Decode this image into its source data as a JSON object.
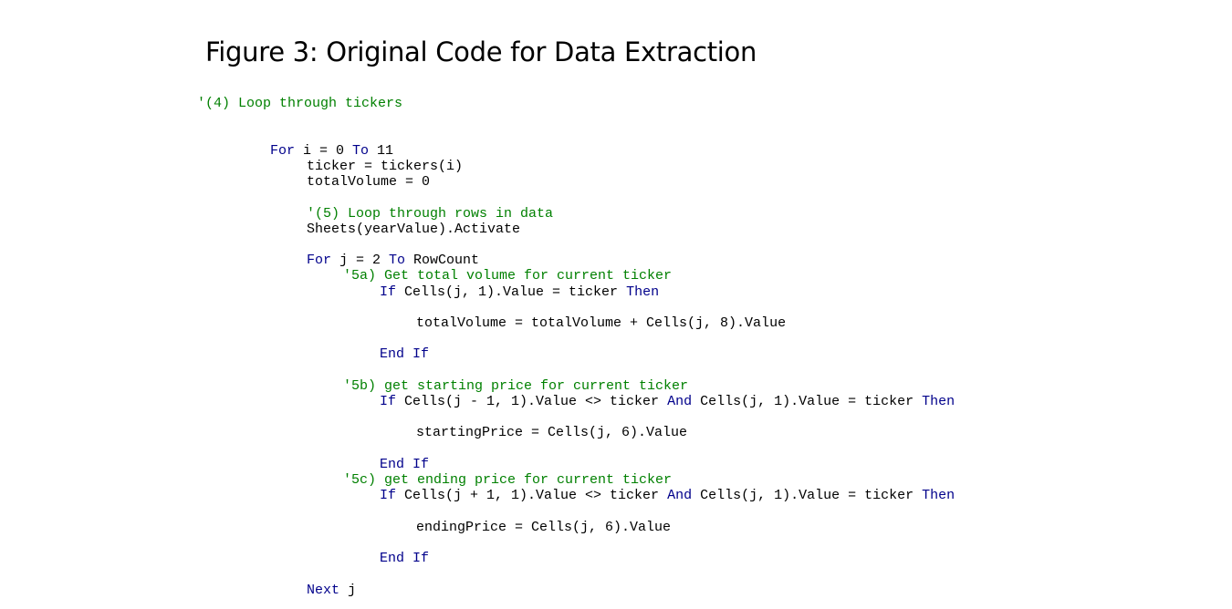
{
  "figure": {
    "title": "Figure 3: Original Code for Data Extraction"
  },
  "colors": {
    "keyword": "#00008b",
    "comment": "#008000",
    "text": "#000000",
    "background": "#ffffff"
  },
  "code": {
    "language": "VBA",
    "lines": [
      {
        "indent": 0,
        "tokens": [
          {
            "type": "comment",
            "text": "'(4) Loop through tickers"
          }
        ]
      },
      {
        "indent": 8,
        "tokens": [
          {
            "type": "kw",
            "text": "For"
          },
          {
            "type": "plain",
            "text": " i = 0 "
          },
          {
            "type": "kw",
            "text": "To"
          },
          {
            "type": "plain",
            "text": " 11"
          }
        ]
      },
      {
        "indent": 12,
        "tokens": [
          {
            "type": "plain",
            "text": "ticker = tickers(i)"
          }
        ]
      },
      {
        "indent": 12,
        "tokens": [
          {
            "type": "plain",
            "text": "totalVolume = 0"
          }
        ]
      },
      {
        "indent": 12,
        "tokens": [
          {
            "type": "comment",
            "text": "'(5) Loop through rows in data"
          }
        ]
      },
      {
        "indent": 12,
        "tokens": [
          {
            "type": "plain",
            "text": "Sheets(yearValue).Activate"
          }
        ]
      },
      {
        "indent": 12,
        "tokens": [
          {
            "type": "kw",
            "text": "For"
          },
          {
            "type": "plain",
            "text": " j = 2 "
          },
          {
            "type": "kw",
            "text": "To"
          },
          {
            "type": "plain",
            "text": " RowCount"
          }
        ]
      },
      {
        "indent": 16,
        "tokens": [
          {
            "type": "comment",
            "text": "'5a) Get total volume for current ticker"
          }
        ]
      },
      {
        "indent": 20,
        "tokens": [
          {
            "type": "kw",
            "text": "If"
          },
          {
            "type": "plain",
            "text": " Cells(j, 1).Value = ticker "
          },
          {
            "type": "kw",
            "text": "Then"
          }
        ]
      },
      {
        "indent": 24,
        "tokens": [
          {
            "type": "plain",
            "text": "totalVolume = totalVolume + Cells(j, 8).Value"
          }
        ]
      },
      {
        "indent": 20,
        "tokens": [
          {
            "type": "kw",
            "text": "End If"
          }
        ]
      },
      {
        "indent": 16,
        "tokens": [
          {
            "type": "comment",
            "text": "'5b) get starting price for current ticker"
          }
        ]
      },
      {
        "indent": 20,
        "tokens": [
          {
            "type": "kw",
            "text": "If"
          },
          {
            "type": "plain",
            "text": " Cells(j - 1, 1).Value <> ticker "
          },
          {
            "type": "kw",
            "text": "And"
          },
          {
            "type": "plain",
            "text": " Cells(j, 1).Value = ticker "
          },
          {
            "type": "kw",
            "text": "Then"
          }
        ]
      },
      {
        "indent": 24,
        "tokens": [
          {
            "type": "plain",
            "text": "startingPrice = Cells(j, 6).Value"
          }
        ]
      },
      {
        "indent": 20,
        "tokens": [
          {
            "type": "kw",
            "text": "End If"
          }
        ]
      },
      {
        "indent": 16,
        "tokens": [
          {
            "type": "comment",
            "text": "'5c) get ending price for current ticker"
          }
        ]
      },
      {
        "indent": 20,
        "tokens": [
          {
            "type": "kw",
            "text": "If"
          },
          {
            "type": "plain",
            "text": " Cells(j + 1, 1).Value <> ticker "
          },
          {
            "type": "kw",
            "text": "And"
          },
          {
            "type": "plain",
            "text": " Cells(j, 1).Value = ticker "
          },
          {
            "type": "kw",
            "text": "Then"
          }
        ]
      },
      {
        "indent": 24,
        "tokens": [
          {
            "type": "plain",
            "text": "endingPrice = Cells(j, 6).Value"
          }
        ]
      },
      {
        "indent": 20,
        "tokens": [
          {
            "type": "kw",
            "text": "End If"
          }
        ]
      },
      {
        "indent": 12,
        "tokens": [
          {
            "type": "kw",
            "text": "Next"
          },
          {
            "type": "plain",
            "text": " j"
          }
        ]
      }
    ]
  }
}
